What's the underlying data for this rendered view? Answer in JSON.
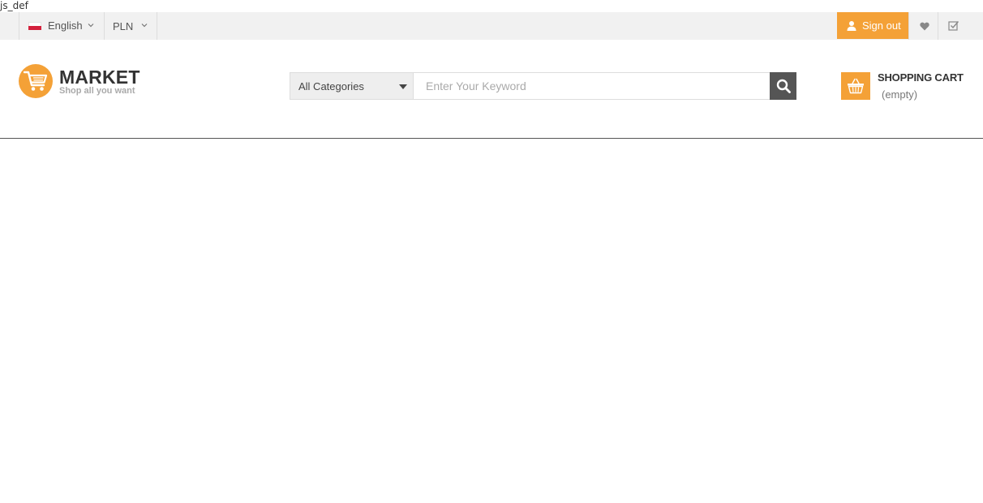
{
  "debug_text": "js_def",
  "topbar": {
    "language": {
      "label": "English",
      "flag_icon": "poland-flag-icon"
    },
    "currency": {
      "label": "PLN"
    },
    "sign_out_label": "Sign out",
    "wishlist_icon": "heart-icon",
    "compare_icon": "checkbox-icon"
  },
  "logo": {
    "brand": "MARKET",
    "tagline": "Shop all you want",
    "icon": "shopping-cart-icon"
  },
  "search": {
    "category": "All Categories",
    "placeholder": "Enter Your Keyword",
    "value": "",
    "button_icon": "search-icon"
  },
  "cart": {
    "title": "SHOPPING CART",
    "status": "(empty)",
    "icon": "basket-icon"
  },
  "colors": {
    "accent": "#f4a137",
    "topbar_bg": "#f1f1f1",
    "search_button": "#555555"
  }
}
